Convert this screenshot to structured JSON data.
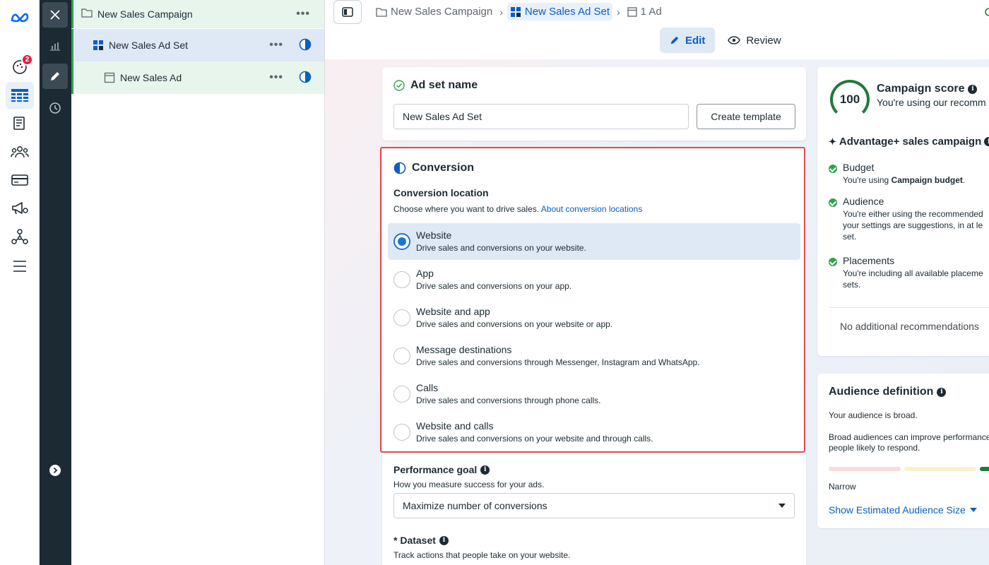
{
  "tree": {
    "campaign": "New Sales Campaign",
    "adset": "New Sales Ad Set",
    "ad": "New Sales Ad"
  },
  "gnav": {
    "notification_count": "2"
  },
  "breadcrumb": {
    "campaign": "New Sales Campaign",
    "adset": "New Sales Ad Set",
    "ad": "1 Ad"
  },
  "modes": {
    "edit": "Edit",
    "review": "Review"
  },
  "adset_name": {
    "title": "Ad set name",
    "value": "New Sales Ad Set",
    "template_button": "Create template"
  },
  "conversion": {
    "title": "Conversion",
    "location_heading": "Conversion location",
    "location_desc": "Choose where you want to drive sales.",
    "location_link": "About conversion locations",
    "options": [
      {
        "label": "Website",
        "desc": "Drive sales and conversions on your website.",
        "selected": true
      },
      {
        "label": "App",
        "desc": "Drive sales and conversions on your app.",
        "selected": false
      },
      {
        "label": "Website and app",
        "desc": "Drive sales and conversions on your website or app.",
        "selected": false
      },
      {
        "label": "Message destinations",
        "desc": "Drive sales and conversions through Messenger, Instagram and WhatsApp.",
        "selected": false
      },
      {
        "label": "Calls",
        "desc": "Drive sales and conversions through phone calls.",
        "selected": false
      },
      {
        "label": "Website and calls",
        "desc": "Drive sales and conversions on your website and through calls.",
        "selected": false
      }
    ],
    "goal_heading": "Performance goal",
    "goal_desc": "How you measure success for your ads.",
    "goal_value": "Maximize number of conversions",
    "dataset_heading": "* Dataset",
    "dataset_desc": "Track actions that people take on your website."
  },
  "score": {
    "value": "100",
    "title": "Campaign score",
    "subtitle": "You're using our recomm",
    "advantage_title": "Advantage+ sales campaign",
    "items": [
      {
        "heading": "Budget",
        "desc1": "You're using ",
        "desc_bold": "Campaign budget",
        "desc2": "."
      },
      {
        "heading": "Audience",
        "lines": [
          "You're either using the recommended",
          "your settings are suggestions, in at le",
          "set."
        ]
      },
      {
        "heading": "Placements",
        "lines": [
          "You're including all available placeme",
          "sets."
        ]
      }
    ],
    "no_recs": "No additional recommendations"
  },
  "audience": {
    "title": "Audience definition",
    "line1": "Your audience is broad.",
    "line2": "Broad audiences can improve performance",
    "line3": "people likely to respond.",
    "narrow": "Narrow",
    "show_size": "Show Estimated Audience Size"
  },
  "colors": {
    "accent": "#0a5fc2",
    "success": "#31a24c",
    "highlight": "#e5484d",
    "rail": "#1c2b33"
  }
}
